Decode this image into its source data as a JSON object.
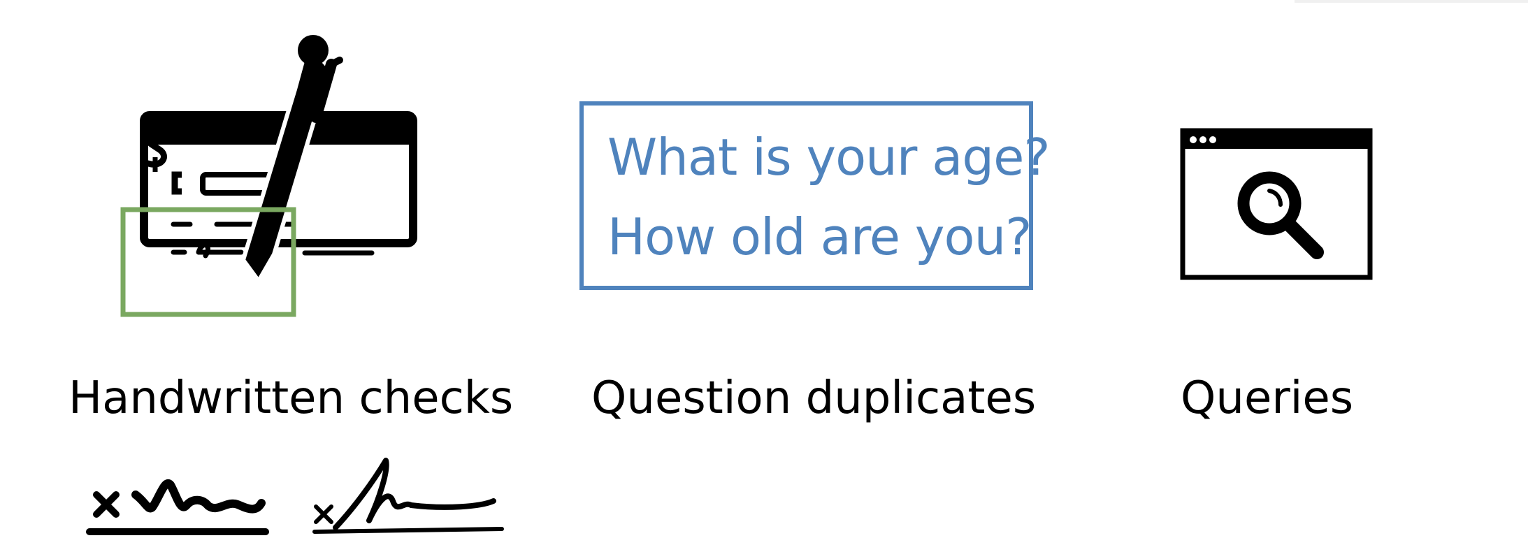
{
  "panels": [
    {
      "caption": "Handwritten checks"
    },
    {
      "caption": "Question duplicates",
      "questions": [
        "What is your age?",
        "How old are you?"
      ]
    },
    {
      "caption": "Queries"
    }
  ],
  "colors": {
    "highlight": "#7aa860",
    "question_text": "#4f83bd",
    "icon": "#000000"
  },
  "icons": [
    "check-icon",
    "pen-icon",
    "dollar-sign-icon",
    "browser-window-icon",
    "magnifier-icon",
    "signature-icon"
  ]
}
